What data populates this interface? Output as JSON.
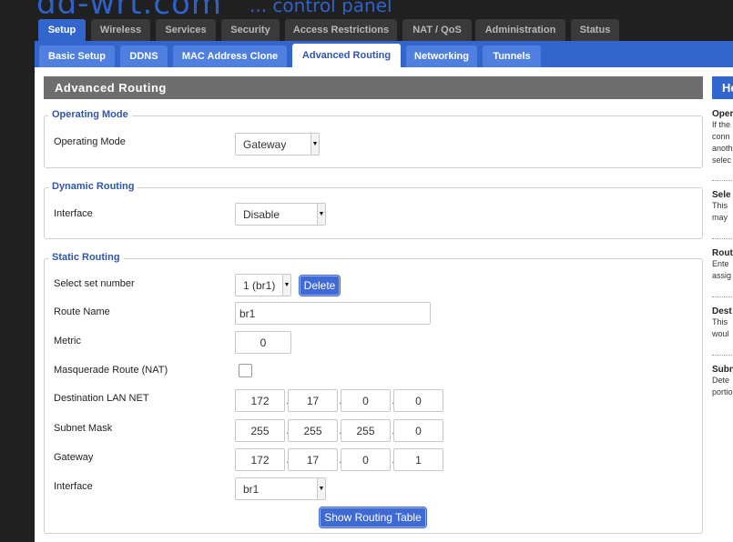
{
  "logo": {
    "brand": "dd-wrt.com",
    "tagline": "... control panel"
  },
  "main_tabs": [
    "Setup",
    "Wireless",
    "Services",
    "Security",
    "Access Restrictions",
    "NAT / QoS",
    "Administration",
    "Status"
  ],
  "sub_tabs": [
    "Basic Setup",
    "DDNS",
    "MAC Address Clone",
    "Advanced Routing",
    "Networking",
    "Tunnels"
  ],
  "page_title": "Advanced Routing",
  "operating_mode": {
    "legend": "Operating Mode",
    "label": "Operating Mode",
    "value": "Gateway"
  },
  "dynamic_routing": {
    "legend": "Dynamic Routing",
    "label": "Interface",
    "value": "Disable"
  },
  "static_routing": {
    "legend": "Static Routing",
    "set_label": "Select set number",
    "set_value": "1 (br1)",
    "delete_label": "Delete",
    "route_name_label": "Route Name",
    "route_name_value": "br1",
    "metric_label": "Metric",
    "metric_value": "0",
    "nat_label": "Masquerade Route (NAT)",
    "nat_checked": false,
    "dest_label": "Destination LAN NET",
    "dest": [
      "172",
      "17",
      "0",
      "0"
    ],
    "mask_label": "Subnet Mask",
    "mask": [
      "255",
      "255",
      "255",
      "0"
    ],
    "gw_label": "Gateway",
    "gw": [
      "172",
      "17",
      "0",
      "1"
    ],
    "iface_label": "Interface",
    "iface_value": "br1",
    "show_table_label": "Show Routing Table"
  },
  "help": {
    "head": "He",
    "blocks": [
      {
        "title": "Oper",
        "lines": [
          "If the",
          "conn",
          "anoth",
          "selec"
        ]
      },
      {
        "title": "Sele",
        "lines": [
          "This",
          "may"
        ]
      },
      {
        "title": "Rout",
        "lines": [
          "Ente",
          "assig"
        ]
      },
      {
        "title": "Dest",
        "lines": [
          "This",
          "woul"
        ]
      },
      {
        "title": "Subn",
        "lines": [
          "Dete",
          "portio"
        ]
      }
    ]
  },
  "colors": {
    "accent": "#3366cc",
    "header_gray": "#6e6e6e",
    "legend": "#2f56a8"
  }
}
